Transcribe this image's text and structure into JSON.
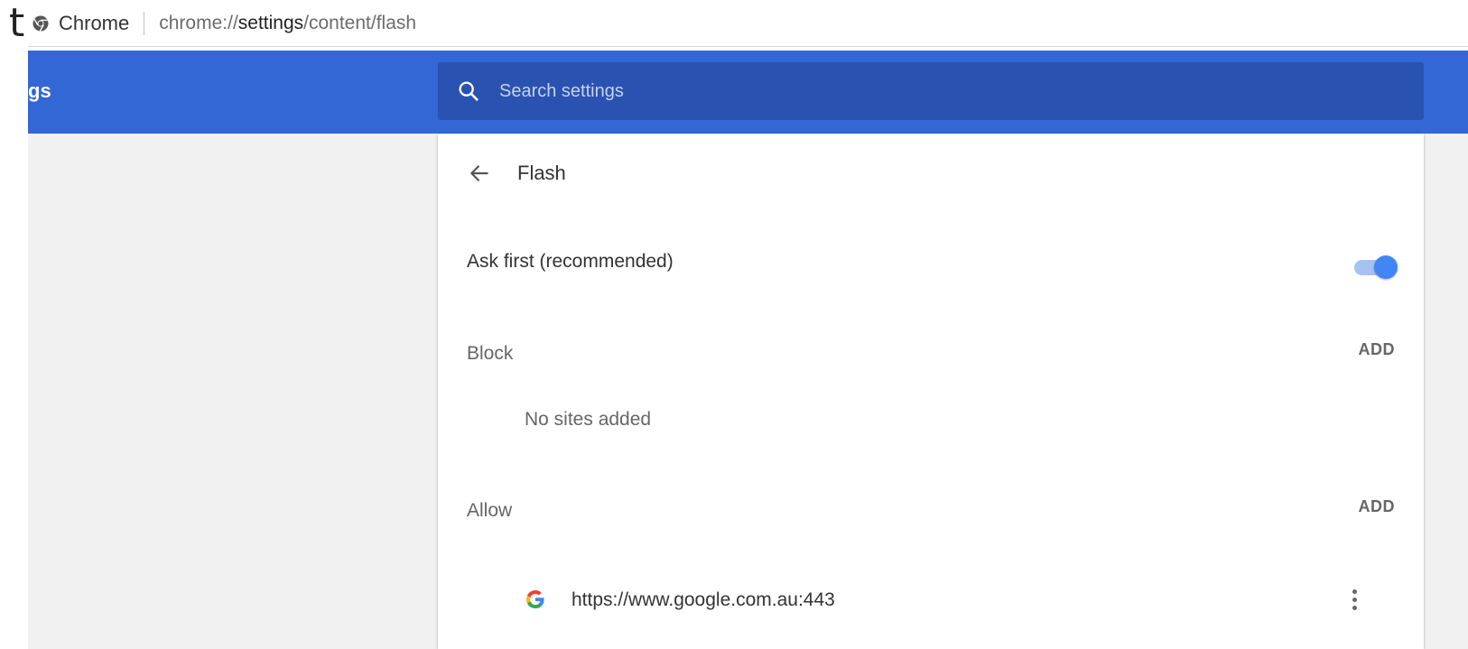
{
  "stray_glyph": "t",
  "omnibox": {
    "site_name": "Chrome",
    "url_prefix": "chrome://",
    "url_strong": "settings",
    "url_suffix": "/content/flash"
  },
  "toolbar": {
    "title": "gs",
    "search_placeholder": "Search settings"
  },
  "page": {
    "title": "Flash",
    "ask_first": {
      "label": "Ask first (recommended)",
      "enabled": true
    },
    "block": {
      "label": "Block",
      "add_label": "ADD",
      "empty_text": "No sites added"
    },
    "allow": {
      "label": "Allow",
      "add_label": "ADD",
      "sites": [
        {
          "url": "https://www.google.com.au:443",
          "icon": "google-g-icon"
        }
      ]
    }
  },
  "colors": {
    "toolbar_blue": "#3367d6",
    "search_blue": "#2a52b0",
    "toggle_on": "#4285f4",
    "sidebar_bg": "#f1f1f1"
  }
}
